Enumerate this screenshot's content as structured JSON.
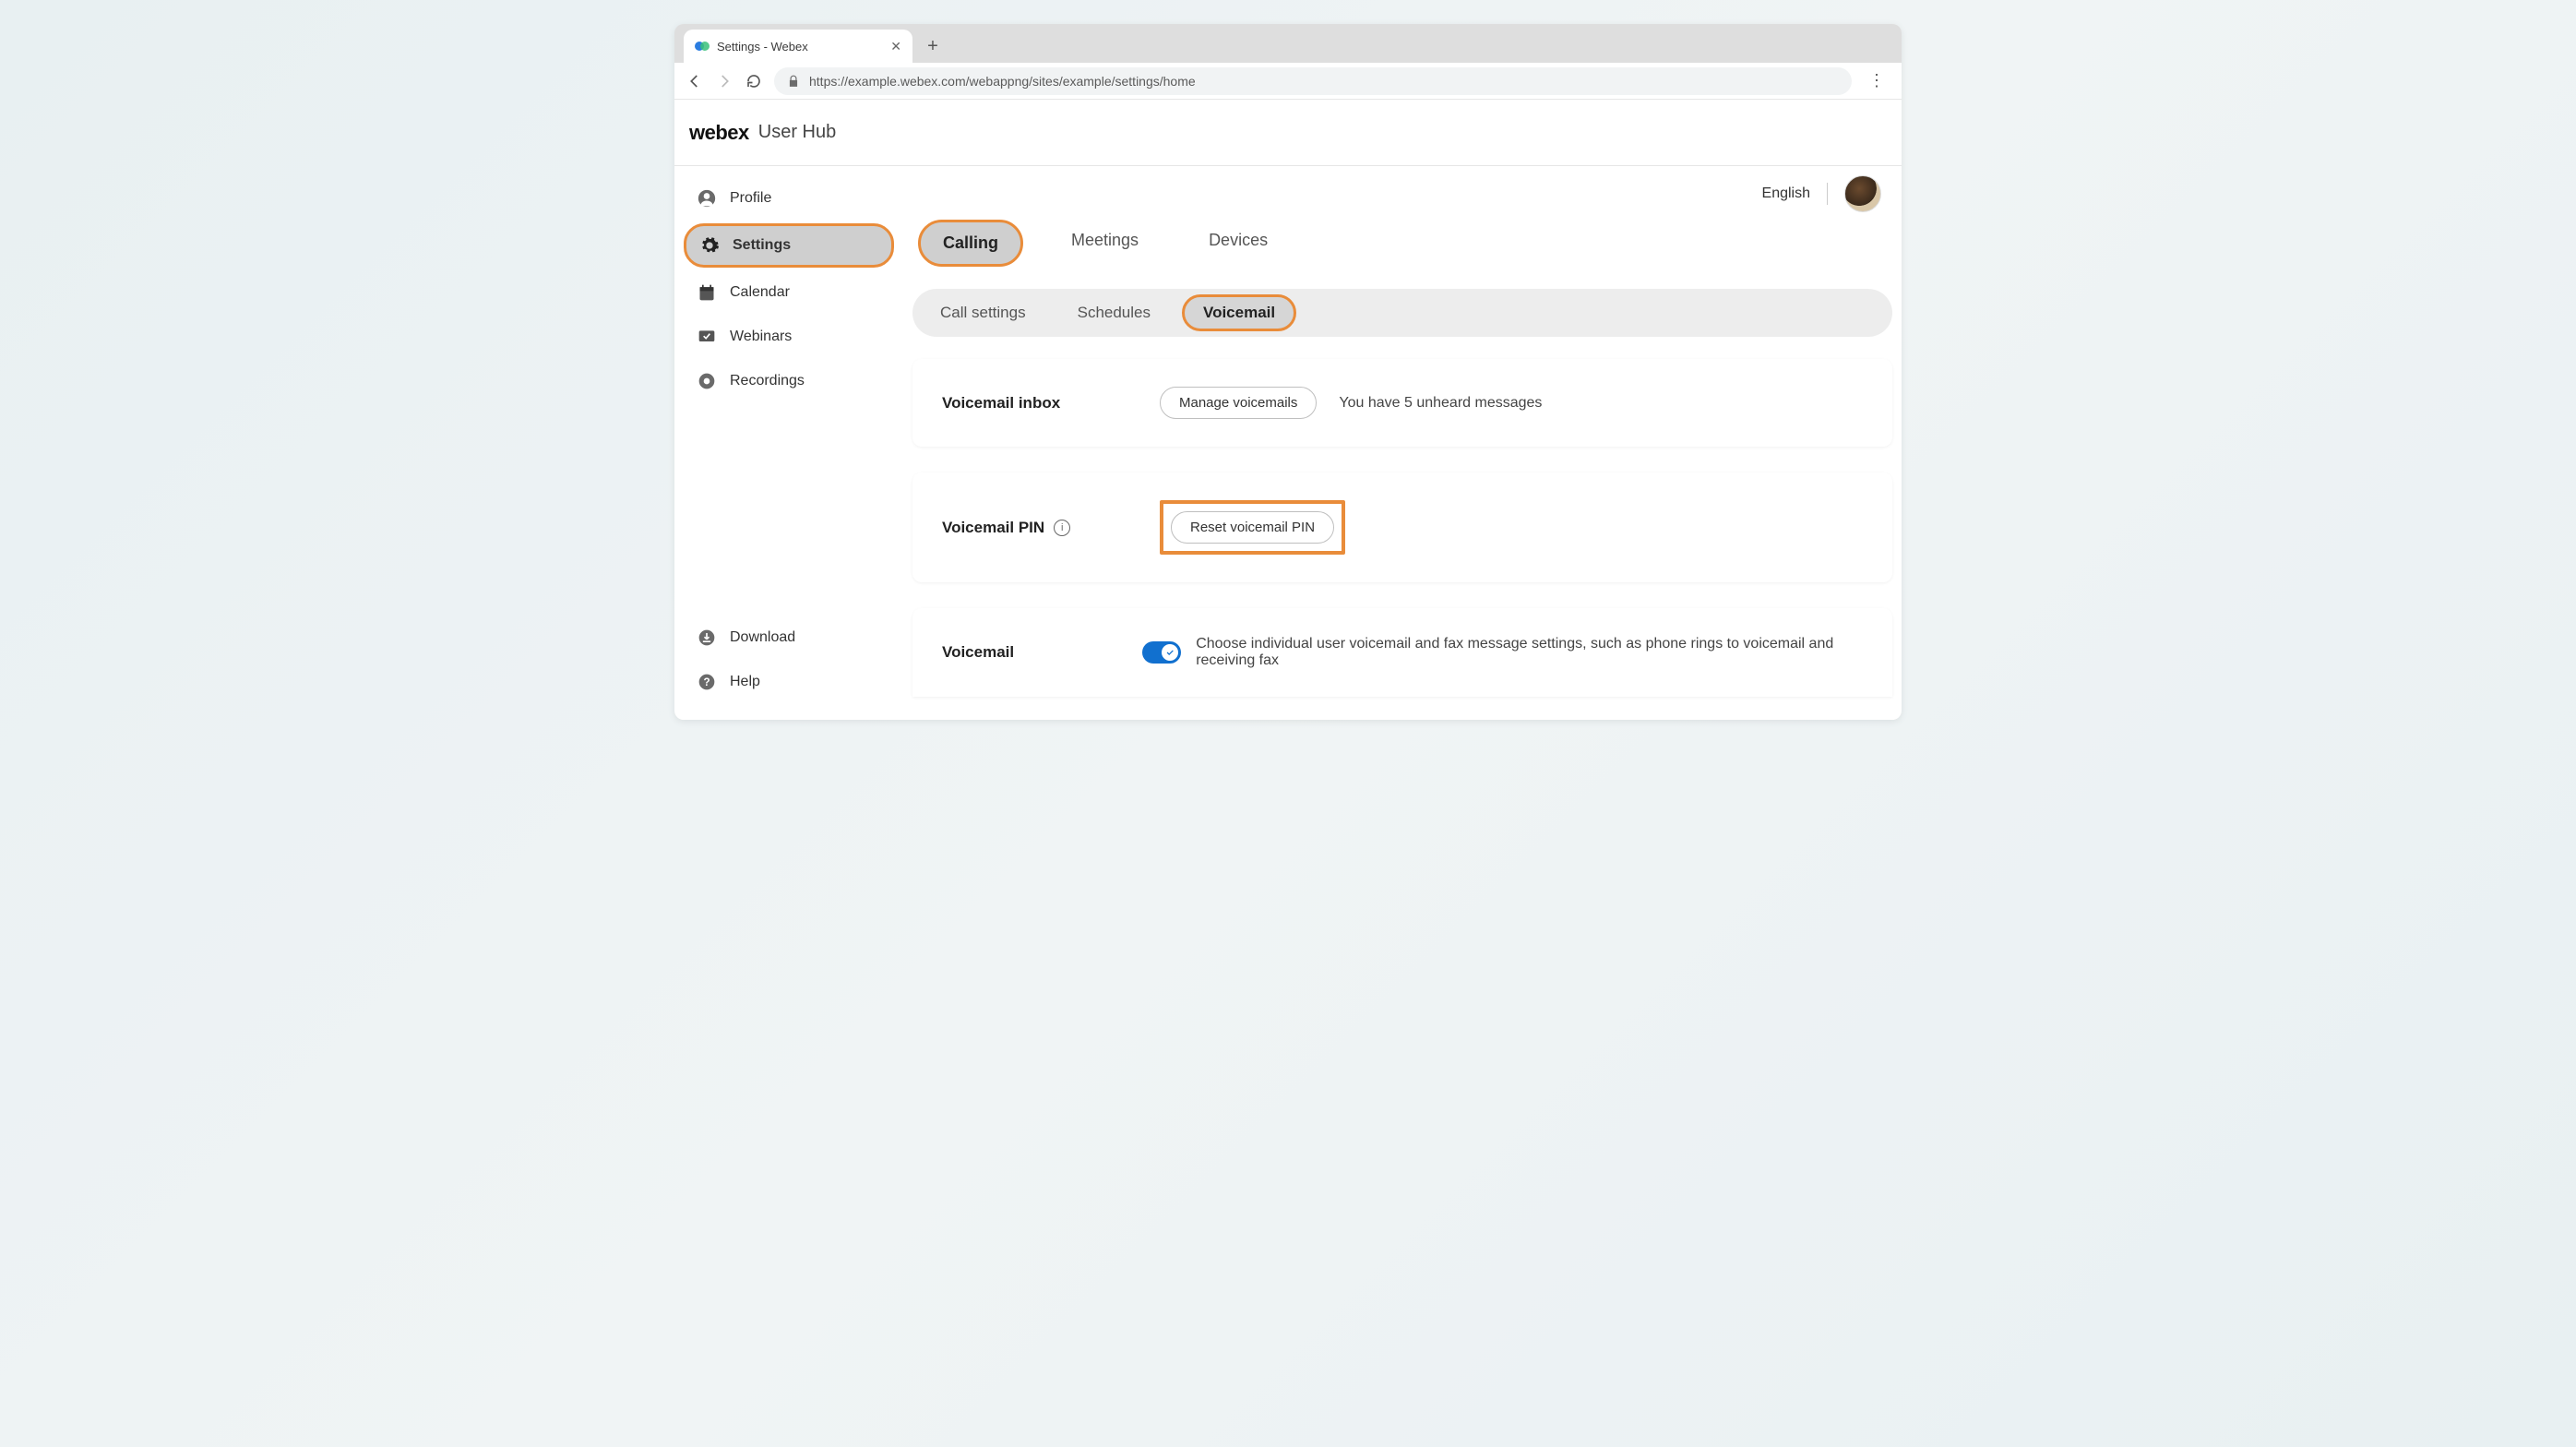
{
  "browser": {
    "tab_title": "Settings - Webex",
    "url": "https://example.webex.com/webappng/sites/example/settings/home"
  },
  "header": {
    "brand": "webex",
    "hub": "User Hub"
  },
  "sidebar": {
    "items": [
      {
        "label": "Profile",
        "icon": "person-icon"
      },
      {
        "label": "Settings",
        "icon": "gear-icon",
        "active": true
      },
      {
        "label": "Calendar",
        "icon": "calendar-icon"
      },
      {
        "label": "Webinars",
        "icon": "webinar-icon"
      },
      {
        "label": "Recordings",
        "icon": "record-icon"
      }
    ],
    "footer": [
      {
        "label": "Download",
        "icon": "download-icon"
      },
      {
        "label": "Help",
        "icon": "help-icon"
      }
    ]
  },
  "topright": {
    "language": "English"
  },
  "tabs": {
    "primary": [
      "Calling",
      "Meetings",
      "Devices"
    ],
    "primary_active": 0,
    "secondary": [
      "Call settings",
      "Schedules",
      "Voicemail"
    ],
    "secondary_active": 2
  },
  "sections": {
    "inbox": {
      "title": "Voicemail inbox",
      "button": "Manage voicemails",
      "status": "You have 5 unheard messages"
    },
    "pin": {
      "title": "Voicemail PIN",
      "button": "Reset voicemail PIN"
    },
    "voicemail": {
      "title": "Voicemail",
      "toggle_on": true,
      "desc": "Choose individual user voicemail and fax message settings, such as phone rings to voicemail and receiving fax"
    }
  }
}
